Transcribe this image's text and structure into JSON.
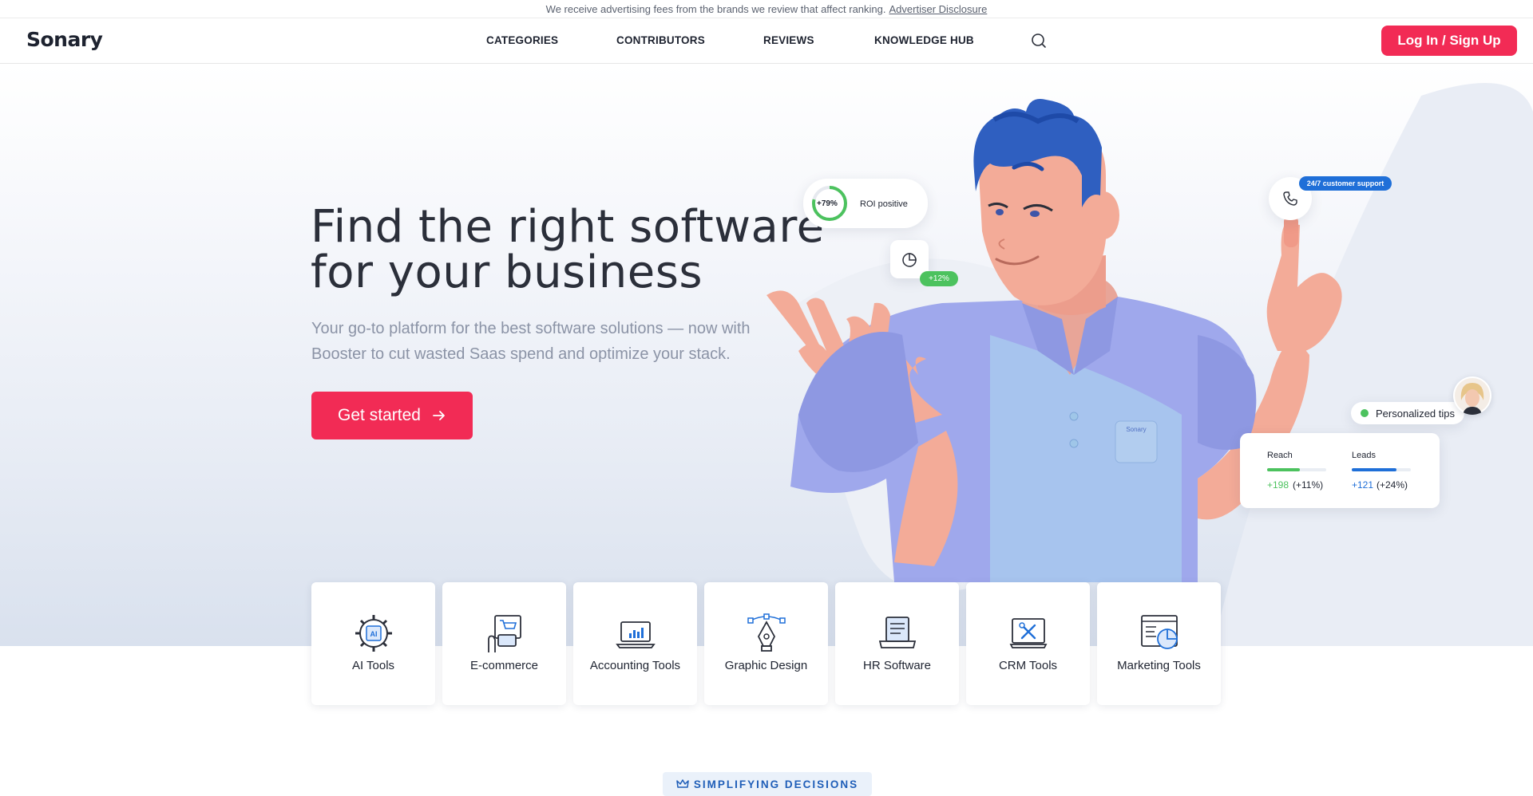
{
  "topbar": {
    "notice": "We receive advertising fees from the brands we review that affect ranking.",
    "disclosure_link": "Advertiser Disclosure"
  },
  "header": {
    "logo": "Sonary",
    "nav": [
      "CATEGORIES",
      "CONTRIBUTORS",
      "REVIEWS",
      "KNOWLEDGE HUB"
    ],
    "search_icon": "search-icon",
    "login_label": "Log In / Sign Up"
  },
  "hero": {
    "title_line1": "Find the right software",
    "title_line2": "for your business",
    "subtitle_line1": "Your go-to platform for the best software solutions — now with",
    "subtitle_line2": "Booster to cut wasted Saas spend and optimize your stack.",
    "cta_label": "Get started"
  },
  "illustration": {
    "roi_value": "+79%",
    "roi_label": "ROI positive",
    "pie_change": "+12%",
    "support_label": "24/7 customer support",
    "shirt_logo": "Sonary",
    "tips_label": "Personalized tips",
    "reach_label": "Reach",
    "reach_value": "+198",
    "reach_pct": "(+11%)",
    "reach_progress": 0.55,
    "leads_label": "Leads",
    "leads_value": "+121",
    "leads_pct": "(+24%)",
    "leads_progress": 0.75,
    "colors": {
      "brand": "#f22b55",
      "blue": "#1f6fd8",
      "green": "#4cc25e"
    }
  },
  "categories": [
    {
      "label": "AI Tools",
      "icon": "ai-gear-icon"
    },
    {
      "label": "E-commerce",
      "icon": "ecommerce-icon"
    },
    {
      "label": "Accounting Tools",
      "icon": "laptop-chart-icon"
    },
    {
      "label": "Graphic Design",
      "icon": "pen-tool-icon"
    },
    {
      "label": "HR Software",
      "icon": "hr-document-icon"
    },
    {
      "label": "CRM Tools",
      "icon": "crm-tools-icon"
    },
    {
      "label": "Marketing Tools",
      "icon": "marketing-chart-icon"
    }
  ],
  "section_badge": {
    "label": "SIMPLIFYING DECISIONS",
    "icon": "crown-icon"
  }
}
